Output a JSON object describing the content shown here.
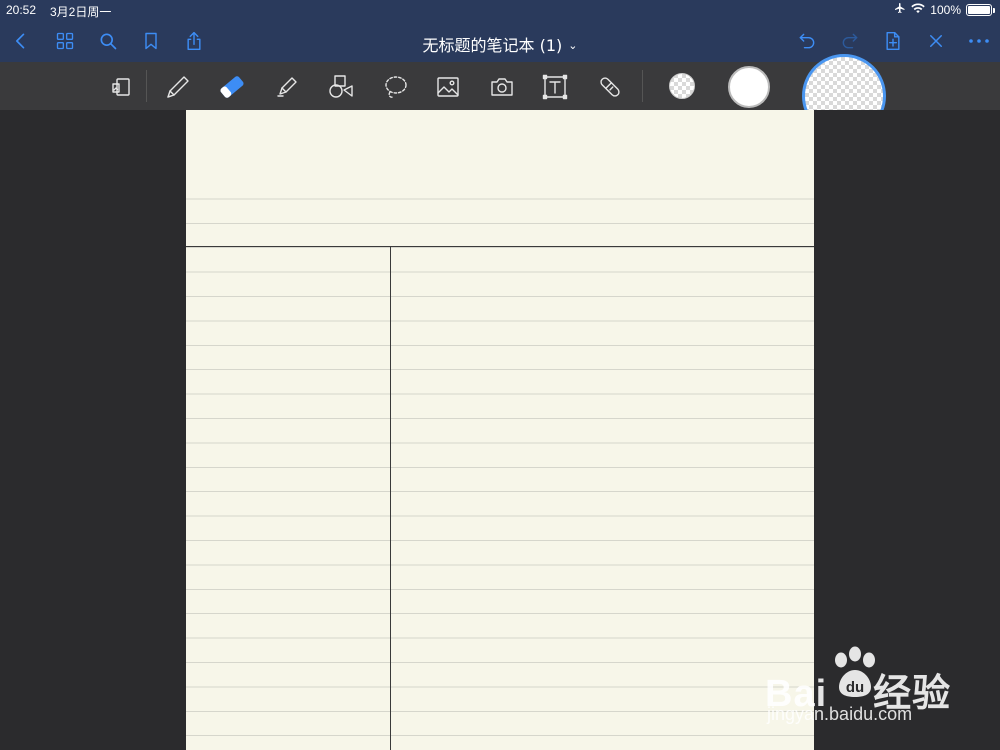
{
  "status_bar": {
    "time": "20:52",
    "date": "3月2日周一",
    "battery": "100%",
    "battery_level": 1.0
  },
  "nav_bar": {
    "title": "无标题的笔记本 (1)",
    "title_chevron": "⌄",
    "accent_color": "#3d8df5"
  },
  "toolbar": {
    "tools": [
      "readonly-view-icon",
      "pen-icon",
      "eraser-icon",
      "highlighter-icon",
      "shapes-icon",
      "lasso-icon",
      "image-icon",
      "camera-icon",
      "text-icon",
      "laser-pointer-icon"
    ],
    "active_tool": "eraser-icon",
    "eraser_sizes": [
      "small",
      "medium",
      "large"
    ],
    "selected_size": "large"
  },
  "page": {
    "paper_color": "#f7f6e9",
    "template": "cornell-notes"
  },
  "watermark": {
    "brand_left": "Bai",
    "brand_right": "经验",
    "site": "jingyan.baidu.com"
  }
}
